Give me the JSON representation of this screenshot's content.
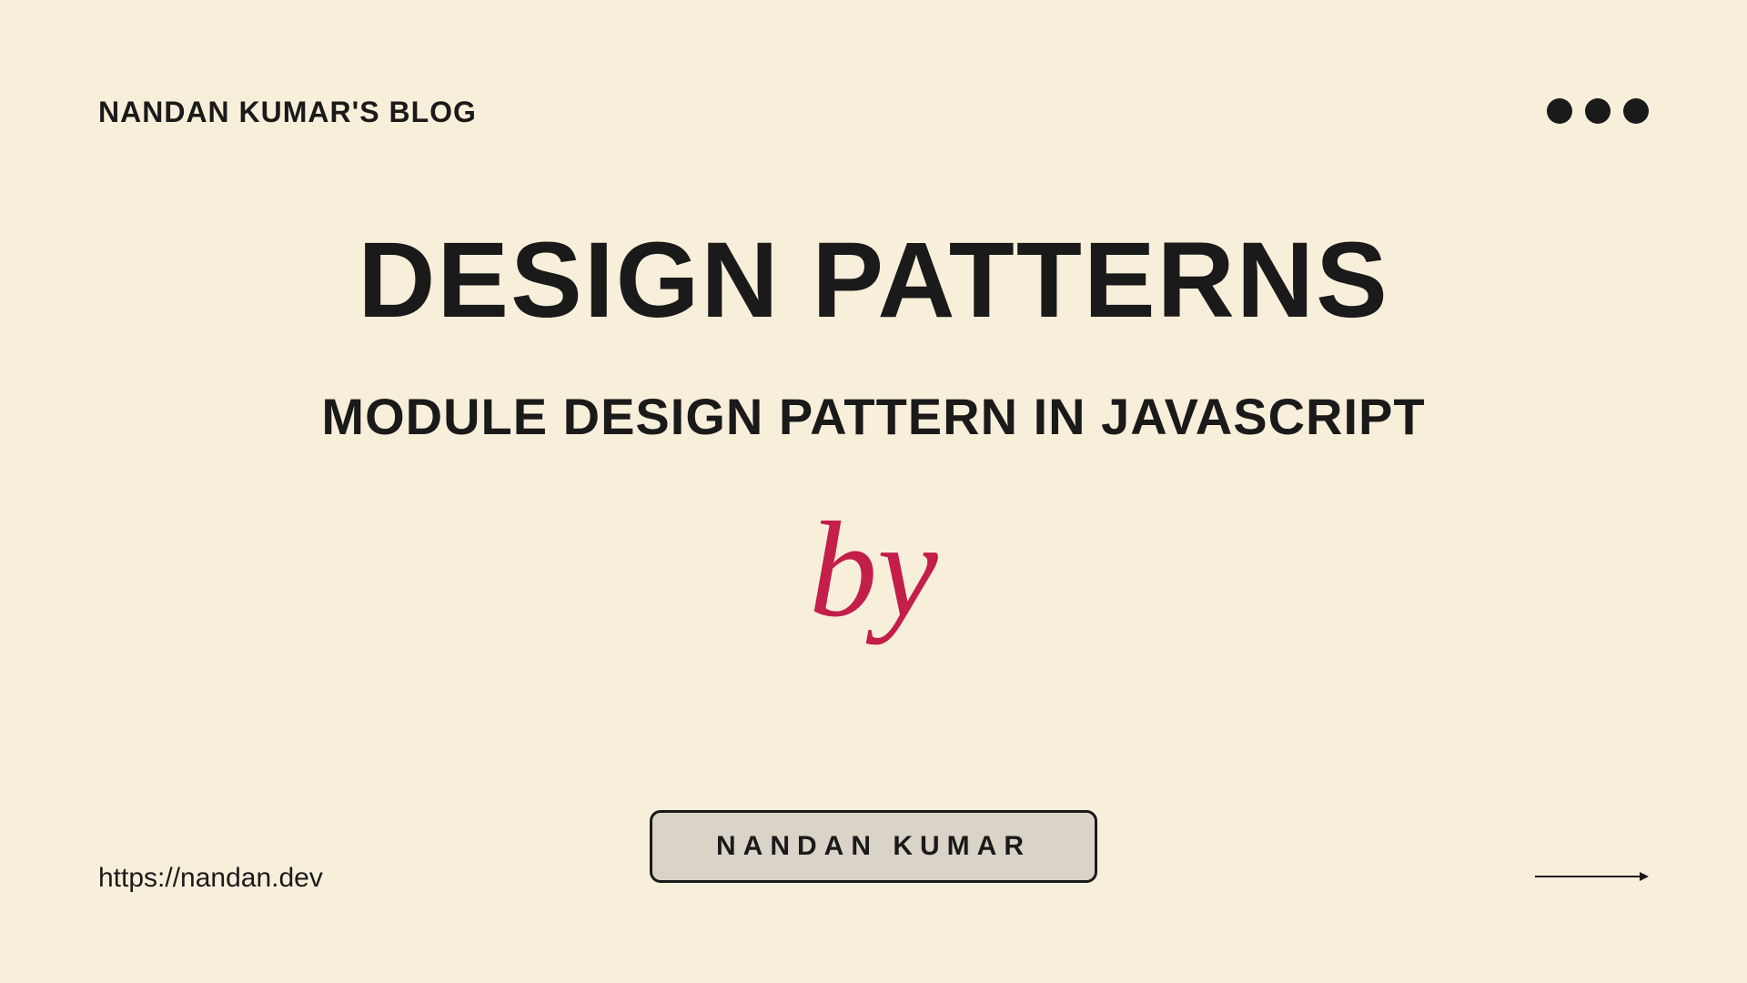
{
  "header": {
    "blog_name": "NANDAN KUMAR'S BLOG"
  },
  "content": {
    "main_title": "DESIGN PATTERNS",
    "subtitle": "Module Design Pattern in Javascript",
    "by_word": "by",
    "author_name": "NANDAN KUMAR"
  },
  "footer": {
    "website_url": "https://nandan.dev"
  },
  "colors": {
    "background": "#f8efdb",
    "text_dark": "#1a1a1a",
    "accent_red": "#c41e4a",
    "box_bg": "#d9d3c8"
  }
}
